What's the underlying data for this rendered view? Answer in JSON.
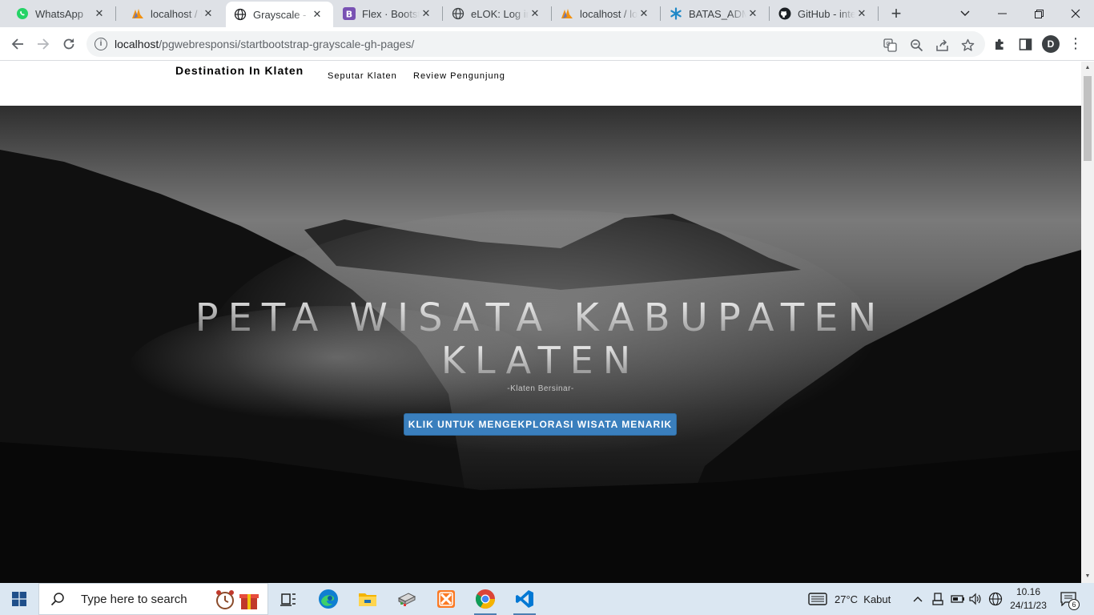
{
  "browser": {
    "tabs": [
      {
        "title": "WhatsApp",
        "icon": "whatsapp-icon",
        "active": false
      },
      {
        "title": "localhost / lo",
        "icon": "phpmyadmin-icon",
        "active": false
      },
      {
        "title": "Grayscale - S",
        "icon": "globe-icon",
        "active": true
      },
      {
        "title": "Flex · Bootstr",
        "icon": "bootstrap-icon",
        "active": false
      },
      {
        "title": "eLOK: Log in",
        "icon": "globe-icon",
        "active": false
      },
      {
        "title": "localhost / lo",
        "icon": "phpmyadmin-icon",
        "active": false
      },
      {
        "title": "BATAS_ADMI",
        "icon": "asterisk-icon",
        "active": false
      },
      {
        "title": "GitHub - inte",
        "icon": "github-icon",
        "active": false
      }
    ],
    "address": {
      "host": "localhost",
      "path": "/pgwebresponsi/startbootstrap-grayscale-gh-pages/"
    },
    "profile_initial": "D"
  },
  "page": {
    "brand": "Destination In Klaten",
    "nav": [
      "Seputar Klaten",
      "Review Pengunjung"
    ],
    "hero": {
      "title_line1": "PETA WISATA KABUPATEN",
      "title_line2": "KLATEN",
      "subtitle": "-Klaten Bersinar-",
      "button": "KLIK UNTUK MENGEKPLORASI WISATA MENARIK"
    }
  },
  "taskbar": {
    "search_placeholder": "Type here to search",
    "weather": "27°C  Kabut",
    "time": "10.16",
    "date": "24/11/23",
    "notification_count": "6"
  },
  "colors": {
    "button": "#3a7fbd",
    "tabstrip": "#dee1e6",
    "taskbar": "#dbe7f2"
  }
}
